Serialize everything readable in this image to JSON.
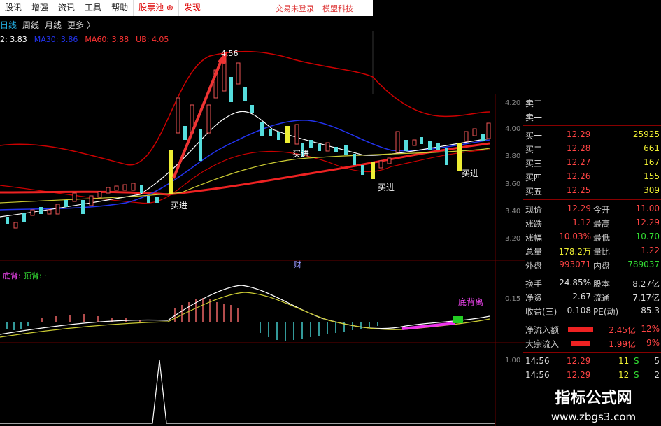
{
  "menu": {
    "items": [
      "股讯",
      "增强",
      "资讯",
      "工具",
      "帮助"
    ],
    "stock_pool": "股票池",
    "discover": "发现",
    "right": [
      "交易未登录",
      "模盟科技"
    ]
  },
  "periods": {
    "items": [
      "日线",
      "周线",
      "月线",
      "更多 〉"
    ],
    "active": 0
  },
  "ma": {
    "ma_a": "2: 3.83",
    "ma_b": "MA30: 3.86",
    "ma_c": "MA60: 3.88",
    "ma_d": "UB: 4.05",
    "colors": {
      "a": "#ffffff",
      "b": "#2233ee",
      "c": "#ff3333",
      "d": "#ff3333"
    }
  },
  "chart_main": {
    "y_ticks": [
      "4.20",
      "4.00",
      "3.80",
      "3.60",
      "3.40",
      "3.20"
    ],
    "high_label": "4.56",
    "buy_labels": [
      "买进",
      "买进",
      "买进",
      "买进"
    ],
    "cai": "财"
  },
  "chart_sub": {
    "legend_a": "底背: ·",
    "legend_b": "顶背: ·",
    "tag": "底背离",
    "y_ticks": [
      "0.15"
    ]
  },
  "chart_vol": {
    "y_ticks": [
      "1.00"
    ]
  },
  "quote": {
    "orders": [
      {
        "label": "卖二",
        "price": "",
        "vol": ""
      },
      {
        "label": "卖一",
        "price": "",
        "vol": ""
      },
      {
        "label": "买一",
        "price": "12.29",
        "vol": "25925"
      },
      {
        "label": "买二",
        "price": "12.28",
        "vol": "661"
      },
      {
        "label": "买三",
        "price": "12.27",
        "vol": "167"
      },
      {
        "label": "买四",
        "price": "12.26",
        "vol": "155"
      },
      {
        "label": "买五",
        "price": "12.25",
        "vol": "309"
      }
    ],
    "stats": [
      {
        "l1": "现价",
        "v1": "12.29",
        "l2": "今开",
        "v2": "11.00"
      },
      {
        "l1": "涨跌",
        "v1": "1.12",
        "l2": "最高",
        "v2": "12.29"
      },
      {
        "l1": "涨幅",
        "v1": "10.03%",
        "l2": "最低",
        "v2": "10.70"
      },
      {
        "l1": "总量",
        "v1": "178.2万",
        "l2": "量比",
        "v2": "1.22"
      },
      {
        "l1": "外盘",
        "v1": "993071",
        "l2": "内盘",
        "v2": "789037"
      }
    ],
    "stats2": [
      {
        "l1": "换手",
        "v1": "24.85%",
        "l2": "股本",
        "v2": "8.27亿"
      },
      {
        "l1": "净资",
        "v1": "2.67",
        "l2": "流通",
        "v2": "7.17亿"
      },
      {
        "l1": "收益(三)",
        "v1": "0.108",
        "l2": "PE(动)",
        "v2": "85.3"
      }
    ],
    "flows": [
      {
        "label": "净流入额",
        "value": "2.45亿",
        "pct": "12%"
      },
      {
        "label": "大宗流入",
        "value": "1.99亿",
        "pct": "9%"
      }
    ],
    "ticks": [
      {
        "time": "14:56",
        "price": "12.29",
        "vol": "11",
        "side": "S",
        "n": "5"
      },
      {
        "time": "14:56",
        "price": "12.29",
        "vol": "12",
        "side": "S",
        "n": "2"
      }
    ]
  },
  "watermark": {
    "title": "指标公式网",
    "url": "www.zbgs3.com"
  }
}
